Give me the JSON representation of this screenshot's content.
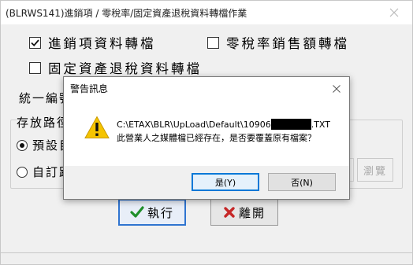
{
  "window": {
    "title": "(BLRWS141)進銷項 / 零稅率/固定資產退稅資料轉檔作業"
  },
  "options": {
    "sales_purchase_label": "進銷項資料轉檔",
    "sales_purchase_checked": true,
    "zero_tax_label": "零稅率銷售額轉檔",
    "zero_tax_checked": false,
    "fixed_asset_label": "固定資產退稅資料轉檔",
    "fixed_asset_checked": false
  },
  "form": {
    "tax_id_label": "統一編號",
    "save_path_group_label": "存放路徑",
    "default_path_label": "預設目",
    "custom_path_label": "自訂路",
    "browse_label": "瀏覽"
  },
  "actions": {
    "execute_label": "執行",
    "leave_label": "離開"
  },
  "dialog": {
    "title": "警告訊息",
    "path_prefix": "C:\\ETAX\\BLR\\UpLoad\\Default\\10906",
    "path_suffix": ".TXT",
    "message": "此營業人之媒體檔已經存在，是否要覆蓋原有檔案？",
    "yes_label": "是(Y)",
    "no_label": "否(N)"
  },
  "colors": {
    "accent": "#0078d7",
    "warning": "#f5c400",
    "execute_icon": "#1f8f2a",
    "leave_icon": "#c62828"
  }
}
